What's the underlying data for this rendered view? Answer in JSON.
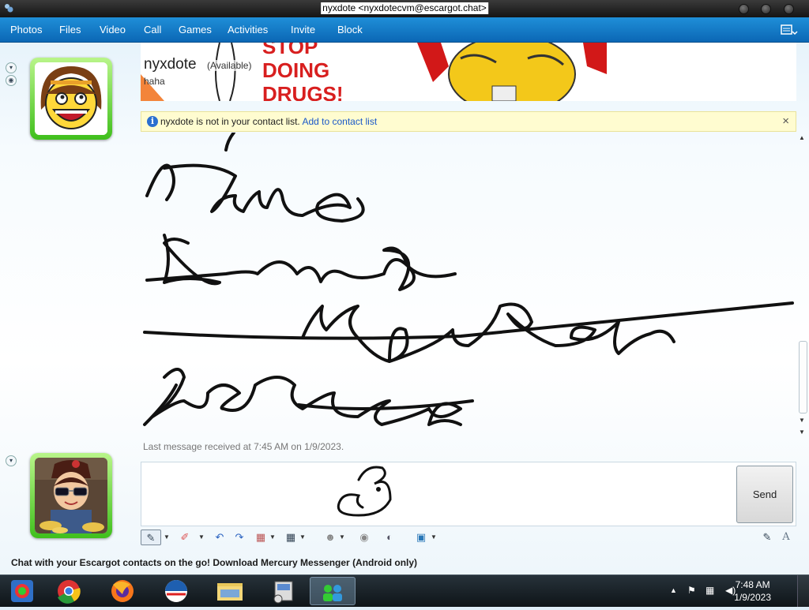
{
  "window": {
    "title": "nyxdote <nyxdotecvm@escargot.chat>"
  },
  "menu": {
    "items": [
      "Photos",
      "Files",
      "Video",
      "Call",
      "Games",
      "Activities",
      "Invite",
      "Block"
    ]
  },
  "contact": {
    "name": "nyxdote",
    "status": "(Available)",
    "personal_message": "haha",
    "banner_text": [
      "STOP",
      "DOING",
      "DRUGS!"
    ]
  },
  "infobar": {
    "text": "nyxdote is not in your contact list.",
    "link": "Add to contact list"
  },
  "conversation": {
    "last_message": "Last message received at 7:45 AM on 1/9/2023."
  },
  "compose": {
    "send_label": "Send"
  },
  "ad": {
    "text": "Chat with your Escargot contacts on the go! Download Mercury Messenger (Android only)"
  },
  "taskbar": {
    "apps": [
      "escargot-messenger",
      "chrome",
      "firefox",
      "msn",
      "file-explorer",
      "network-tool",
      "messenger-contacts"
    ],
    "clock_time": "7:48 AM",
    "clock_date": "1/9/2023"
  },
  "colors": {
    "menubar": "#0b67b5",
    "infobar": "#fffcd0",
    "avatar_frame": "#3fbf1c",
    "link": "#1a58c8"
  }
}
